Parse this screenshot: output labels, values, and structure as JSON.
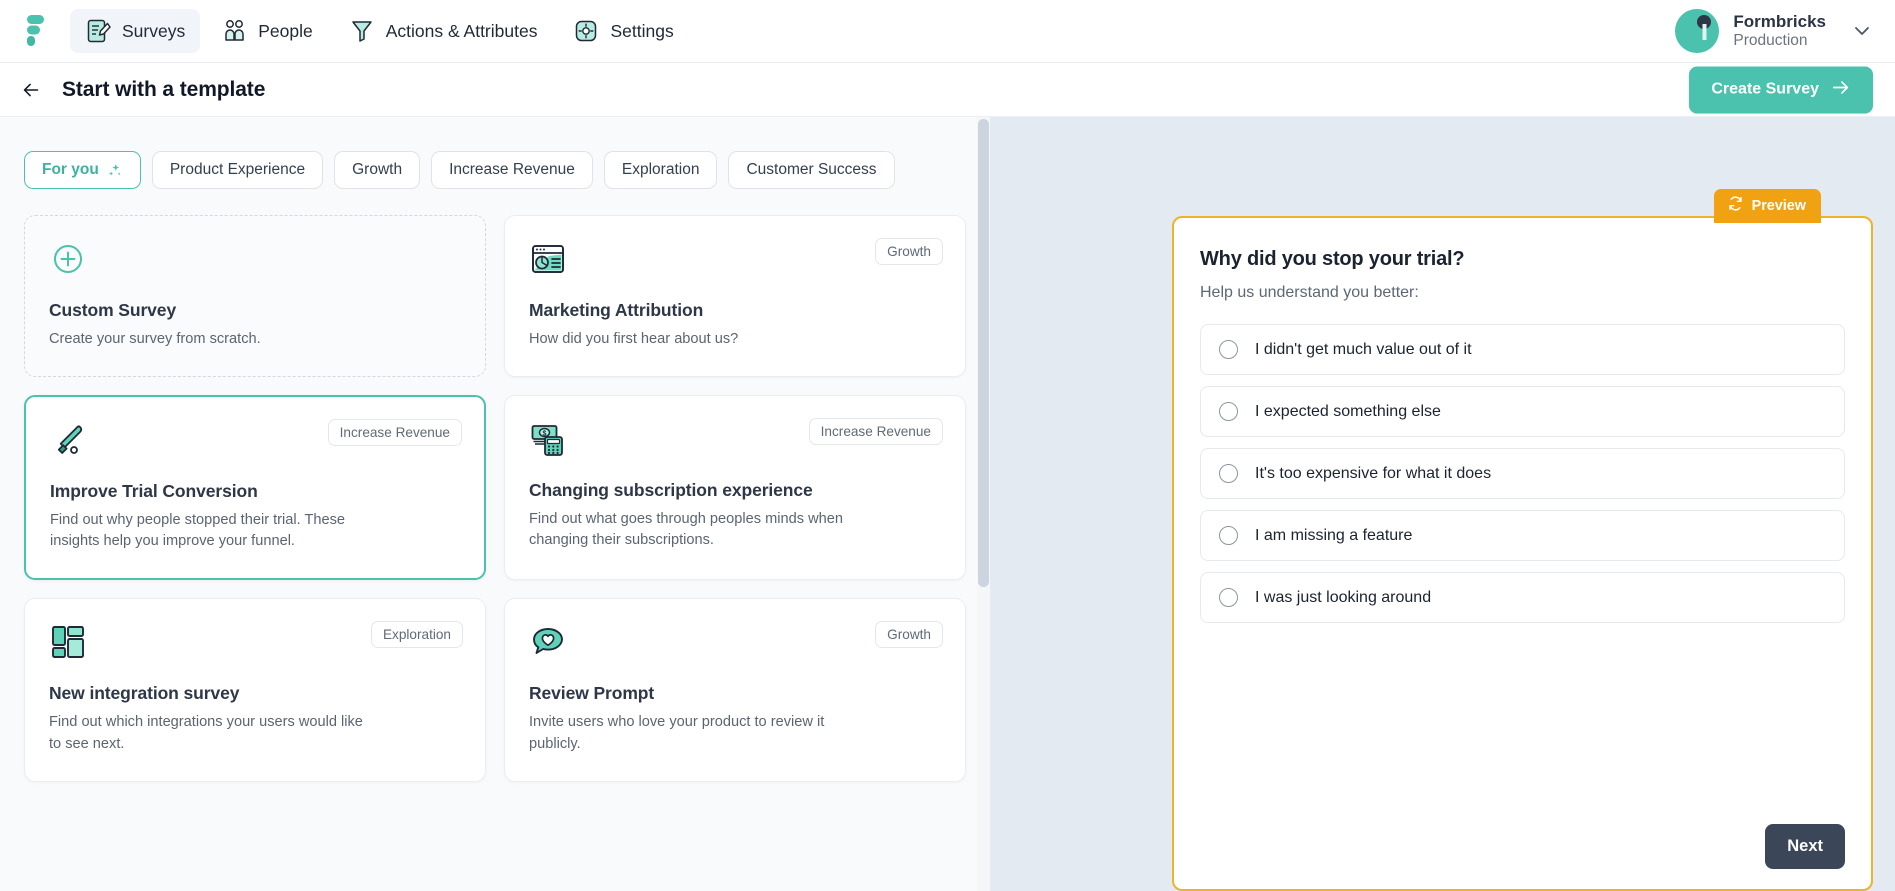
{
  "topnav": {
    "logo_icon": "formbricks-logo-icon",
    "items": [
      {
        "label": "Surveys",
        "icon": "surveys-icon",
        "active": true
      },
      {
        "label": "People",
        "icon": "people-icon",
        "active": false
      },
      {
        "label": "Actions & Attributes",
        "icon": "funnel-icon",
        "active": false
      },
      {
        "label": "Settings",
        "icon": "gear-icon",
        "active": false
      }
    ],
    "org": {
      "name": "Formbricks",
      "environment": "Production",
      "avatar_icon": "org-avatar",
      "chevron_icon": "chevron-down-icon"
    }
  },
  "pagehead": {
    "back_icon": "arrow-left-icon",
    "title": "Start with a template",
    "create_label": "Create Survey",
    "create_icon": "arrow-right-icon"
  },
  "filters": [
    {
      "label": "For you",
      "icon": "sparkles-icon",
      "active": true
    },
    {
      "label": "Product Experience",
      "icon": "",
      "active": false
    },
    {
      "label": "Growth",
      "icon": "",
      "active": false
    },
    {
      "label": "Increase Revenue",
      "icon": "",
      "active": false
    },
    {
      "label": "Exploration",
      "icon": "",
      "active": false
    },
    {
      "label": "Customer Success",
      "icon": "",
      "active": false
    }
  ],
  "templates": [
    {
      "title": "Custom Survey",
      "desc": "Create your survey from scratch.",
      "badge": "",
      "icon": "plus-circle-icon",
      "style": "dashed"
    },
    {
      "title": "Marketing Attribution",
      "desc": "How did you first hear about us?",
      "badge": "Growth",
      "icon": "browser-pie-chart-icon",
      "style": "normal"
    },
    {
      "title": "Improve Trial Conversion",
      "desc": "Find out why people stopped their trial. These insights help you improve your funnel.",
      "badge": "Increase Revenue",
      "icon": "baseball-bat-icon",
      "style": "selected"
    },
    {
      "title": "Changing subscription experience",
      "desc": "Find out what goes through peoples minds when changing their subscriptions.",
      "badge": "Increase Revenue",
      "icon": "money-calculator-icon",
      "style": "normal"
    },
    {
      "title": "New integration survey",
      "desc": "Find out which integrations your users would like to see next.",
      "badge": "Exploration",
      "icon": "blocks-layout-icon",
      "style": "normal"
    },
    {
      "title": "Review Prompt",
      "desc": "Invite users who love your product to review it publicly.",
      "badge": "Growth",
      "icon": "speech-bubble-heart-icon",
      "style": "normal"
    }
  ],
  "preview": {
    "badge_label": "Preview",
    "badge_icon": "refresh-icon",
    "question": "Why did you stop your trial?",
    "subtitle": "Help us understand you better:",
    "options": [
      "I didn't get much value out of it",
      "I expected something else",
      "It's too expensive for what it does",
      "I am missing a feature",
      "I was just looking around"
    ],
    "next_label": "Next"
  },
  "colors": {
    "accent_teal": "#4ac2ad",
    "preview_orange": "#f0a213",
    "preview_border": "#edb32b",
    "next_navy": "#3b4759",
    "right_bg": "#e4eaf1",
    "left_bg": "#f9fafb"
  }
}
